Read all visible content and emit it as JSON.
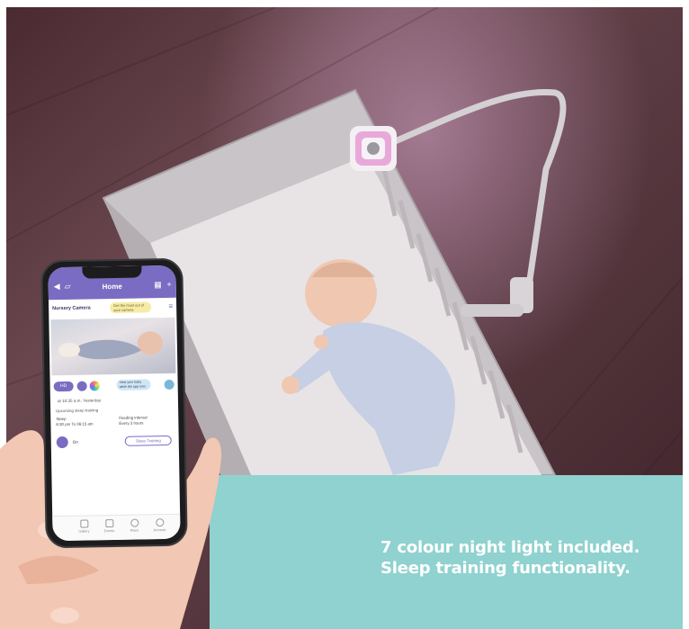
{
  "caption": {
    "line1": "7 colour night light included.",
    "line2": "Sleep training functionality."
  },
  "phone_app": {
    "header_title": "Home",
    "camera_name": "Nursery Camera",
    "camera_tip": "Get the most out of your camera",
    "video_tip": "View your baby while the app runs",
    "control_pill": "HD",
    "status_time": "at 10:35 a.m. Yesterday",
    "section_label": "Upcoming sleep training",
    "event_left_title": "Sleep",
    "event_left_time": "6:30 pm To 06:15 am",
    "event_right_title": "Feeding interval",
    "event_right_time": "Every 3 hours",
    "toggle_label": "On",
    "sleep_training_button": "Sleep Training",
    "tabs": [
      "Gallery",
      "Events",
      "Plans",
      "Account"
    ]
  },
  "colors": {
    "teal_panel": "#8fd2cf",
    "app_accent": "#7a6cc2",
    "night_light_glow": "#e48fd0"
  }
}
